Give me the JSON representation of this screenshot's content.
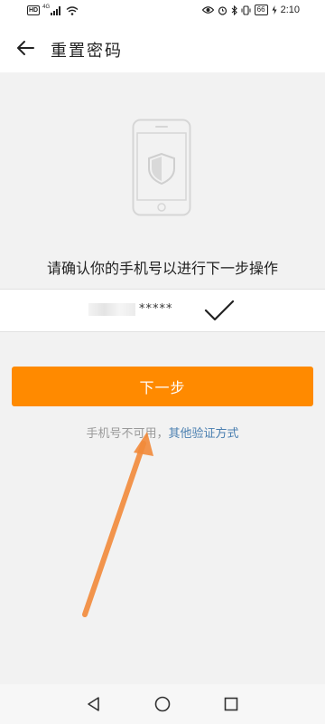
{
  "status_bar": {
    "hd": "HD",
    "network": "4G",
    "battery": "66",
    "time": "2:10"
  },
  "header": {
    "title": "重置密码",
    "back_icon": "arrow-left-icon"
  },
  "main": {
    "illustration_icon": "phone-shield-icon",
    "prompt": "请确认你的手机号以进行下一步操作",
    "phone_masked": "*****",
    "selected_icon": "checkmark-icon",
    "next_label": "下一步",
    "alt_prefix": "手机号不可用，",
    "alt_link": "其他验证方式"
  },
  "nav_bar": {
    "back": "triangle-back-icon",
    "home": "circle-home-icon",
    "recents": "square-recents-icon"
  },
  "colors": {
    "accent": "#ff8a00",
    "link": "#4a7fb0",
    "background": "#f2f2f2",
    "annotation_arrow": "#f28a3a"
  }
}
